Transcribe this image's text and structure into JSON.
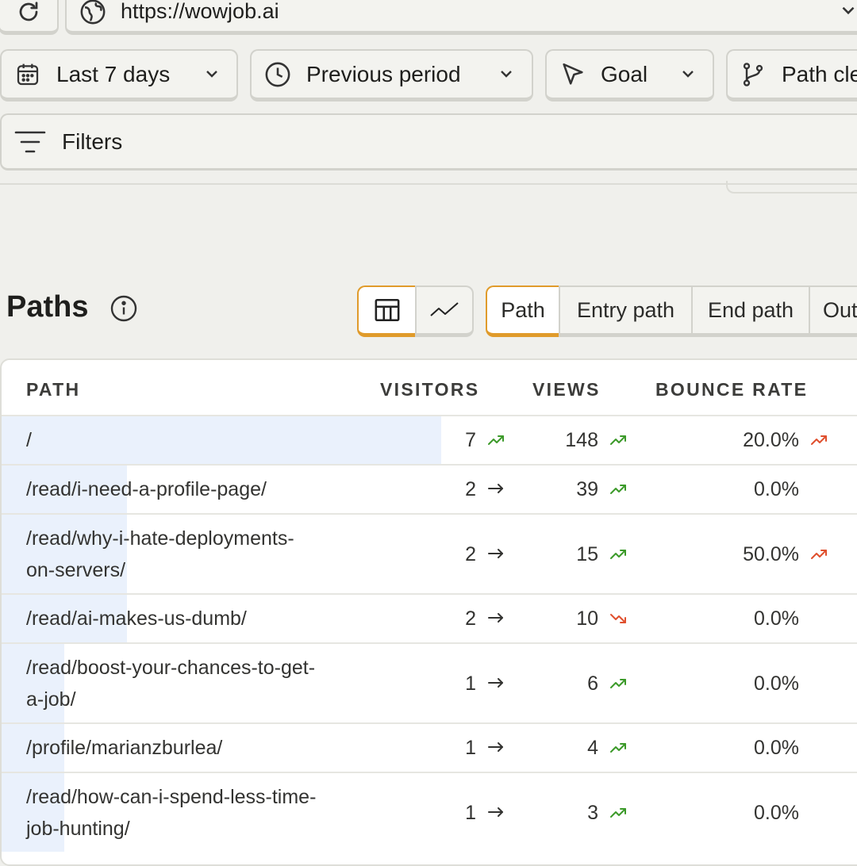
{
  "browser": {
    "url": "https://wowjob.ai"
  },
  "toolbar": {
    "date_range": "Last 7 days",
    "comparison": "Previous period",
    "goal": "Goal",
    "path_cleaning": "Path cle",
    "filters": "Filters"
  },
  "section": {
    "title": "Paths",
    "tabs": [
      "Path",
      "Entry path",
      "End path",
      "Out"
    ],
    "active_tab": "Path",
    "active_view": "table"
  },
  "table": {
    "columns": [
      "PATH",
      "VISITORS",
      "VIEWS",
      "BOUNCE RATE"
    ],
    "rows": [
      {
        "path_lines": [
          "/"
        ],
        "visitors": "7",
        "visitors_trend": "up",
        "views": "148",
        "views_trend": "up",
        "bounce": "20.0%",
        "bounce_trend": "up-bad",
        "share": 1.0
      },
      {
        "path_lines": [
          "/read/i-need-a-profile-page/"
        ],
        "visitors": "2",
        "visitors_trend": "flat",
        "views": "39",
        "views_trend": "up",
        "bounce": "0.0%",
        "bounce_trend": "none",
        "share": 0.286
      },
      {
        "path_lines": [
          "/read/why-i-hate-deployments-",
          "on-servers/"
        ],
        "visitors": "2",
        "visitors_trend": "flat",
        "views": "15",
        "views_trend": "up",
        "bounce": "50.0%",
        "bounce_trend": "up-bad",
        "share": 0.286
      },
      {
        "path_lines": [
          "/read/ai-makes-us-dumb/"
        ],
        "visitors": "2",
        "visitors_trend": "flat",
        "views": "10",
        "views_trend": "down-bad",
        "bounce": "0.0%",
        "bounce_trend": "none",
        "share": 0.286
      },
      {
        "path_lines": [
          "/read/boost-your-chances-to-get-",
          "a-job/"
        ],
        "visitors": "1",
        "visitors_trend": "flat",
        "views": "6",
        "views_trend": "up",
        "bounce": "0.0%",
        "bounce_trend": "none",
        "share": 0.143
      },
      {
        "path_lines": [
          "/profile/marianzburlea/"
        ],
        "visitors": "1",
        "visitors_trend": "flat",
        "views": "4",
        "views_trend": "up",
        "bounce": "0.0%",
        "bounce_trend": "none",
        "share": 0.143
      },
      {
        "path_lines": [
          "/read/how-can-i-spend-less-time-",
          "job-hunting/"
        ],
        "visitors": "1",
        "visitors_trend": "flat",
        "views": "3",
        "views_trend": "up",
        "bounce": "0.0%",
        "bounce_trend": "none",
        "share": 0.143
      }
    ]
  },
  "colors": {
    "accent": "#e09b2b",
    "trend_good": "#3c9a2a",
    "trend_bad": "#e0502e",
    "bar_fill": "#eaf1fc"
  }
}
